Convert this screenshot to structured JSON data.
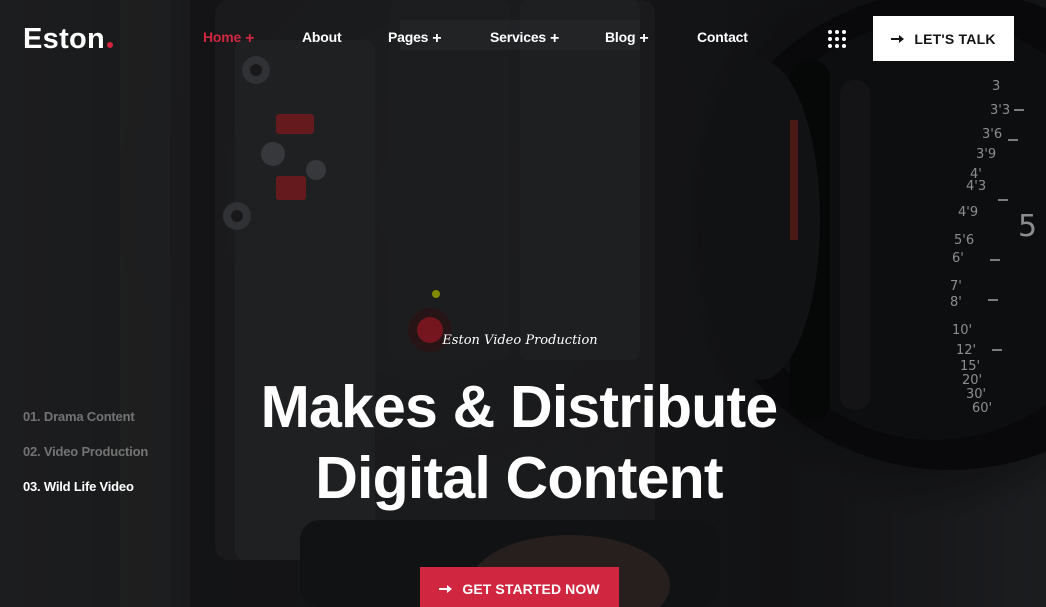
{
  "brand": {
    "name": "Eston",
    "accent_color": "#d0263f"
  },
  "nav": {
    "items": [
      {
        "label": "Home",
        "has_submenu": true,
        "active": true
      },
      {
        "label": "About",
        "has_submenu": false,
        "active": false
      },
      {
        "label": "Pages",
        "has_submenu": true,
        "active": false
      },
      {
        "label": "Services",
        "has_submenu": true,
        "active": false
      },
      {
        "label": "Blog",
        "has_submenu": true,
        "active": false
      },
      {
        "label": "Contact",
        "has_submenu": false,
        "active": false
      }
    ],
    "submenu_glyph": "+",
    "grid_icon": "grid-dots-icon"
  },
  "header_cta": {
    "label": "LET'S TALK",
    "icon": "arrow-right-icon"
  },
  "slides": {
    "items": [
      {
        "label": "01. Drama Content",
        "active": false
      },
      {
        "label": "02. Video Production",
        "active": false
      },
      {
        "label": "03. Wild Life Video",
        "active": true
      }
    ]
  },
  "hero": {
    "eyebrow": "Eston Video Production",
    "headline_line1": "Makes & Distribute",
    "headline_line2": "Digital Content",
    "cta_label": "GET STARTED NOW",
    "cta_icon": "arrow-right-icon",
    "background_image": "cinema-camera-photo"
  }
}
